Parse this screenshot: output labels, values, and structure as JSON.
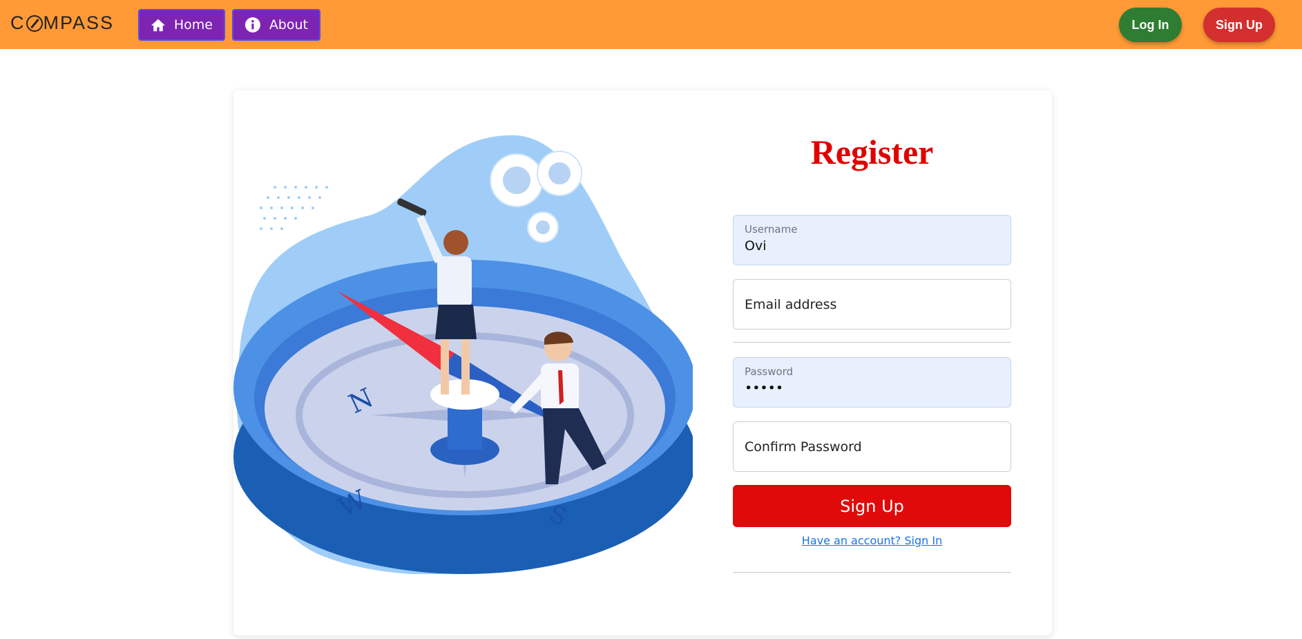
{
  "nav": {
    "logo_text_before": "C",
    "logo_text_after": "MPASS",
    "home_label": "Home",
    "about_label": "About",
    "login_label": "Log In",
    "signup_label": "Sign Up"
  },
  "form": {
    "title": "Register",
    "username": {
      "label": "Username",
      "value": "Ovi"
    },
    "email": {
      "placeholder": "Email address"
    },
    "password": {
      "label": "Password",
      "value": "•••••"
    },
    "confirm": {
      "placeholder": "Confirm Password"
    },
    "submit_label": "Sign Up",
    "signin_link": "Have an account? Sign In"
  },
  "colors": {
    "navbar": "#ff9a36",
    "nav_button": "#7d24b3",
    "login": "#2e7d32",
    "signup": "#d32f2f",
    "title": "#e00000",
    "submit": "#e00a0a",
    "link": "#1a73e8"
  },
  "icons": [
    "home-icon",
    "info-icon",
    "compass-logo-icon"
  ]
}
